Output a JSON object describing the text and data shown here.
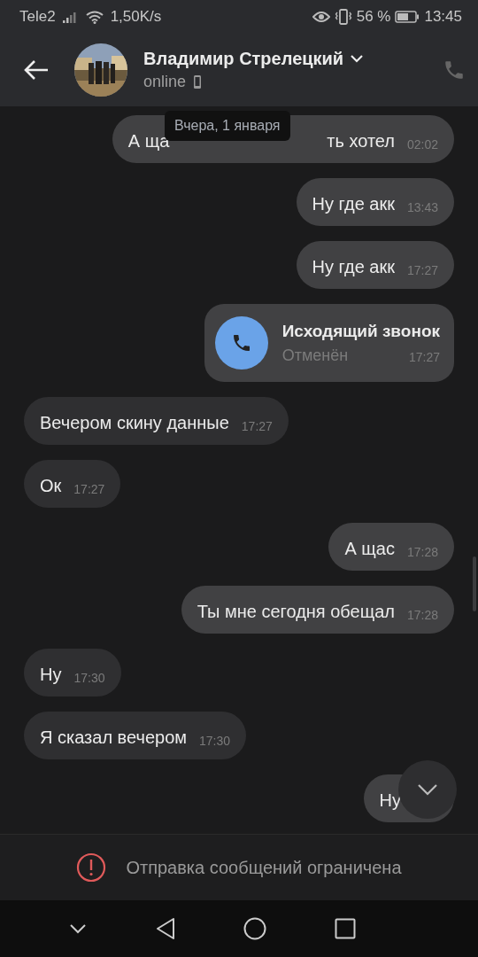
{
  "status_bar": {
    "carrier": "Tele2",
    "speed": "1,50K/s",
    "battery": "56 %",
    "time": "13:45"
  },
  "header": {
    "name": "Владимир Стрелецкий",
    "status": "online"
  },
  "date_chip": "Вчера, 1 января",
  "messages": [
    {
      "kind": "partial",
      "outgoing": true,
      "text_start": "А ща",
      "text_end": "ть хотел",
      "time": "02:02"
    },
    {
      "kind": "text",
      "outgoing": true,
      "text": "Ну где акк",
      "time": "13:43"
    },
    {
      "kind": "text",
      "outgoing": true,
      "text": "Ну где акк",
      "time": "17:27"
    },
    {
      "kind": "call",
      "outgoing": true,
      "text": "Исходящий звонок",
      "subtext": "Отменён",
      "time": "17:27"
    },
    {
      "kind": "text",
      "outgoing": false,
      "text": "Вечером скину данные",
      "time": "17:27"
    },
    {
      "kind": "text",
      "outgoing": false,
      "text": "Ок",
      "time": "17:27"
    },
    {
      "kind": "text",
      "outgoing": true,
      "text": "А щас",
      "time": "17:28"
    },
    {
      "kind": "text",
      "outgoing": true,
      "text": "Ты мне сегодня обещал",
      "time": "17:28"
    },
    {
      "kind": "text",
      "outgoing": false,
      "text": "Ну",
      "time": "17:30"
    },
    {
      "kind": "text",
      "outgoing": false,
      "text": "Я сказал вечером",
      "time": "17:30"
    },
    {
      "kind": "text",
      "outgoing": true,
      "text": "Ну"
    }
  ],
  "notice": "Отправка сообщений ограничена"
}
